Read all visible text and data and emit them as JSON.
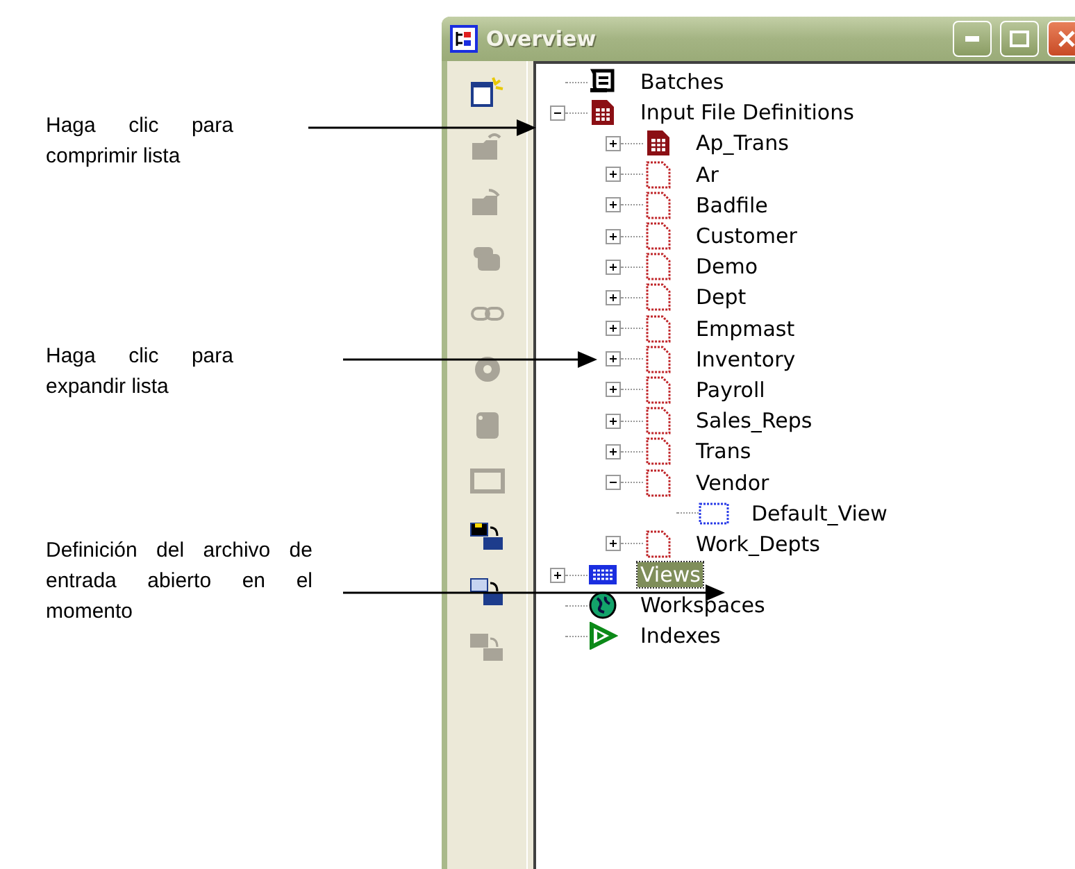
{
  "callouts": [
    {
      "text": "Haga clic para comprimir lista"
    },
    {
      "text": "Haga clic para expandir lista"
    },
    {
      "text": "Definición del archivo de entrada abierto en el momento"
    }
  ],
  "window": {
    "title": "Overview"
  },
  "toolbar": [
    {
      "kind": "new",
      "disabled": false
    },
    {
      "kind": "folder-out",
      "disabled": true
    },
    {
      "kind": "folder-in",
      "disabled": true
    },
    {
      "kind": "stack",
      "disabled": true
    },
    {
      "kind": "link",
      "disabled": true
    },
    {
      "kind": "gear",
      "disabled": true
    },
    {
      "kind": "cylinder",
      "disabled": true
    },
    {
      "kind": "frame",
      "disabled": true
    },
    {
      "kind": "swap-dark",
      "disabled": false
    },
    {
      "kind": "swap-light",
      "disabled": false
    },
    {
      "kind": "swap-grey",
      "disabled": true
    }
  ],
  "tree": [
    {
      "label": "Batches",
      "kind": "batches",
      "selected": false
    },
    {
      "label": "Input File Definitions",
      "kind": "definition",
      "selected": false,
      "expanded": true,
      "children": [
        {
          "label": "Ap_Trans",
          "kind": "definition",
          "selected": false,
          "expanded": false
        },
        {
          "label": "Ar",
          "kind": "file",
          "selected": false,
          "expanded": false
        },
        {
          "label": "Badfile",
          "kind": "file",
          "selected": false,
          "expanded": false
        },
        {
          "label": "Customer",
          "kind": "file",
          "selected": false,
          "expanded": false
        },
        {
          "label": "Demo",
          "kind": "file",
          "selected": false,
          "expanded": false
        },
        {
          "label": "Dept",
          "kind": "file",
          "selected": false,
          "expanded": false
        },
        {
          "label": "Empmast",
          "kind": "file",
          "selected": false,
          "expanded": false
        },
        {
          "label": "Inventory",
          "kind": "file",
          "selected": false,
          "expanded": false
        },
        {
          "label": "Payroll",
          "kind": "file",
          "selected": false,
          "expanded": false
        },
        {
          "label": "Sales_Reps",
          "kind": "file",
          "selected": false,
          "expanded": false
        },
        {
          "label": "Trans",
          "kind": "file",
          "selected": false,
          "expanded": false
        },
        {
          "label": "Vendor",
          "kind": "file",
          "selected": false,
          "expanded": true,
          "children": [
            {
              "label": "Default_View",
              "kind": "view",
              "selected": false
            }
          ]
        },
        {
          "label": "Work_Depts",
          "kind": "file",
          "selected": false,
          "expanded": false
        }
      ]
    },
    {
      "label": "Views",
      "kind": "views",
      "selected": true,
      "expanded": false
    },
    {
      "label": "Workspaces",
      "kind": "workspaces",
      "selected": false
    },
    {
      "label": "Indexes",
      "kind": "indexes",
      "selected": false
    }
  ]
}
